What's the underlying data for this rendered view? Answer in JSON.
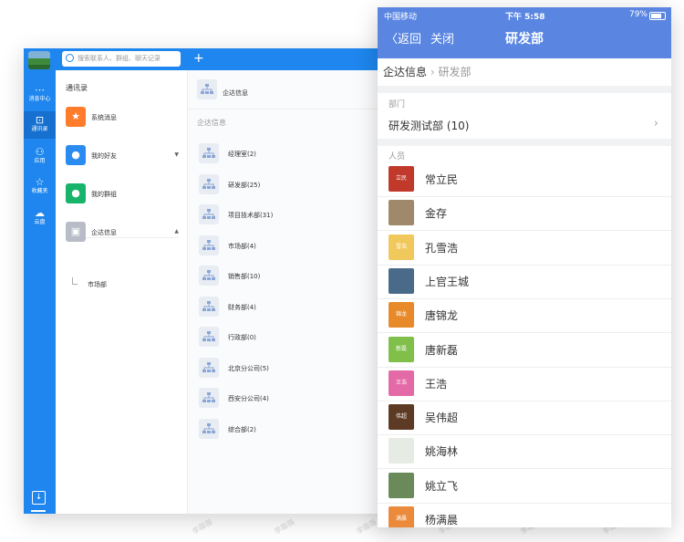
{
  "desktop": {
    "search_placeholder": "搜索联系人、群组、聊天记录",
    "plus_label": "+",
    "nav": [
      {
        "label": "消息中心",
        "glyph": "⋯"
      },
      {
        "label": "通讯录",
        "glyph": "⊡"
      },
      {
        "label": "应用",
        "glyph": "⚇"
      },
      {
        "label": "收藏夹",
        "glyph": "☆"
      },
      {
        "label": "云盘",
        "glyph": "☁"
      }
    ],
    "contacts_title": "通讯录",
    "groups": [
      {
        "label": "系统消息",
        "color": "#ff7c2b",
        "glyph": "★"
      },
      {
        "label": "我的好友",
        "color": "#2a8cf0",
        "glyph": "●",
        "arrow": "▼"
      },
      {
        "label": "我的群组",
        "color": "#18b46c",
        "glyph": "●"
      },
      {
        "label": "企达信息",
        "color": "#b7bcc6",
        "glyph": "▣",
        "arrow": "▲"
      }
    ],
    "sub_item": "市场部",
    "main": {
      "title": "企达信息",
      "section": "企达信息",
      "departments": [
        "经理室(2)",
        "研发部(25)",
        "项目技术部(31)",
        "市场部(4)",
        "销售部(10)",
        "财务部(4)",
        "行政部(0)",
        "北京分公司(5)",
        "西安分公司(4)",
        "综合部(2)"
      ]
    }
  },
  "phone": {
    "carrier": "中国移动",
    "time": "下午 5:58",
    "battery": "79%",
    "back_label": "〈返回",
    "close_label": "关闭",
    "title": "研发部",
    "breadcrumb_root": "企达信息",
    "breadcrumb_sep": "›",
    "breadcrumb_current": "研发部",
    "dept_section": "部门",
    "dept_name": "研发测试部 (10)",
    "dept_chevron": "›",
    "people_section": "人员",
    "people": [
      {
        "name": "常立民",
        "avatar_text": "立民",
        "color": "#c0392b"
      },
      {
        "name": "金存",
        "avatar_text": "",
        "color": "#a0896a"
      },
      {
        "name": "孔雪浩",
        "avatar_text": "雪浩",
        "color": "#f1c85b"
      },
      {
        "name": "上官王城",
        "avatar_text": "",
        "color": "#4a6a8a"
      },
      {
        "name": "唐锦龙",
        "avatar_text": "锦龙",
        "color": "#e88a2a"
      },
      {
        "name": "唐新磊",
        "avatar_text": "新磊",
        "color": "#7fbf4a"
      },
      {
        "name": "王浩",
        "avatar_text": "王浩",
        "color": "#e36aa6"
      },
      {
        "name": "吴伟超",
        "avatar_text": "伟超",
        "color": "#5c3a24"
      },
      {
        "name": "姚海林",
        "avatar_text": "",
        "color": "#e6ece4"
      },
      {
        "name": "姚立飞",
        "avatar_text": "",
        "color": "#6a8a5a"
      },
      {
        "name": "杨满晨",
        "avatar_text": "满晨",
        "color": "#ea8a3a"
      }
    ]
  },
  "watermark": "李薇薇"
}
